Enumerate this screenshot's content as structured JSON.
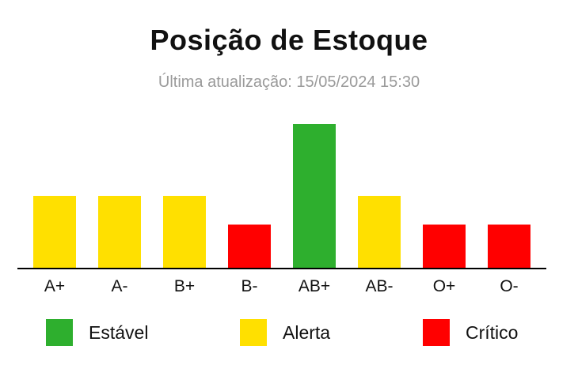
{
  "header": {
    "title": "Posição de Estoque",
    "subtitle": "Última atualização: 15/05/2024 15:30"
  },
  "colors": {
    "estavel": "#2eaf2e",
    "alerta": "#ffe000",
    "critico": "#ff0000",
    "axis": "#000000"
  },
  "chart_data": {
    "type": "bar",
    "title": "Posição de Estoque",
    "subtitle": "Última atualização: 15/05/2024 15:30",
    "xlabel": "",
    "ylabel": "",
    "categories": [
      "A+",
      "A-",
      "B+",
      "B-",
      "AB+",
      "AB-",
      "O+",
      "O-"
    ],
    "values": [
      50,
      50,
      50,
      30,
      100,
      50,
      30,
      30
    ],
    "status": [
      "Alerta",
      "Alerta",
      "Alerta",
      "Crítico",
      "Estável",
      "Alerta",
      "Crítico",
      "Crítico"
    ],
    "ylim": [
      0,
      100
    ],
    "grid": false,
    "legend_position": "bottom"
  },
  "legend": [
    {
      "label": "Estável",
      "color": "#2eaf2e"
    },
    {
      "label": "Alerta",
      "color": "#ffe000"
    },
    {
      "label": "Crítico",
      "color": "#ff0000"
    }
  ]
}
